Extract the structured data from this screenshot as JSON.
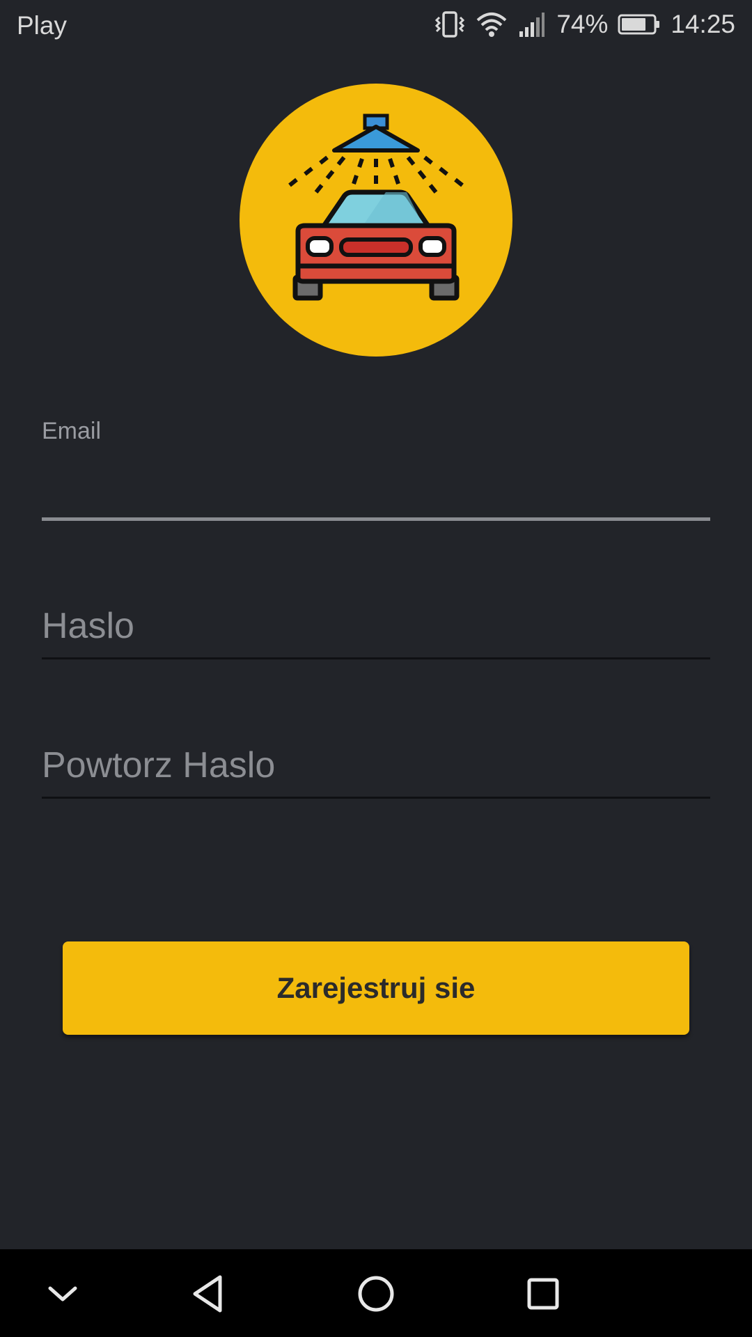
{
  "status_bar": {
    "carrier": "Play",
    "battery_percent": "74%",
    "time": "14:25",
    "icons": [
      "vibrate-icon",
      "wifi-icon",
      "signal-icon",
      "battery-icon"
    ]
  },
  "logo": {
    "icon": "car-wash-icon",
    "background_color": "#F4BB0C"
  },
  "form": {
    "email_label": "Email",
    "email_value": "",
    "password_placeholder": "Haslo",
    "repeat_password_placeholder": "Powtorz Haslo"
  },
  "register_button": {
    "label": "Zarejestruj sie",
    "color": "#F4BB0C"
  },
  "nav_bar": {
    "icons": [
      "collapse-chevron-icon",
      "back-triangle-icon",
      "home-circle-icon",
      "recents-square-icon"
    ]
  },
  "colors": {
    "background": "#222429",
    "accent": "#F4BB0C",
    "nav_background": "#000000"
  }
}
